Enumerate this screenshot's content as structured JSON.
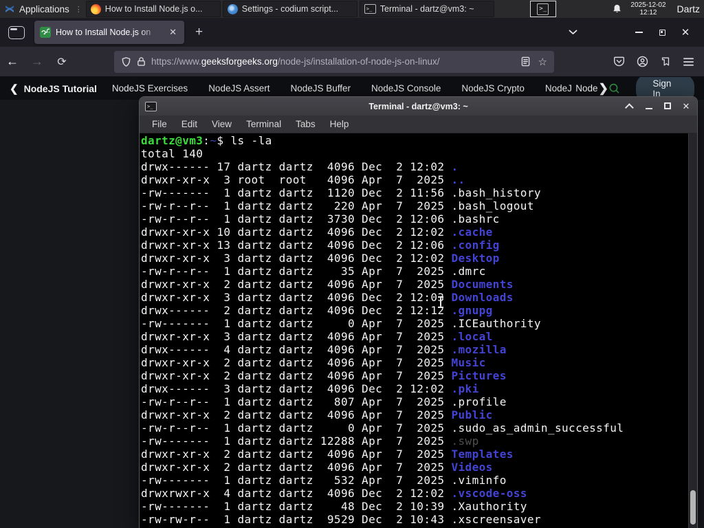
{
  "panel": {
    "applications_label": "Applications",
    "windows": [
      {
        "icon": "firefox",
        "title": "How to Install Node.js o..."
      },
      {
        "icon": "vscodium",
        "title": "Settings - codium script..."
      },
      {
        "icon": "terminal",
        "title": "Terminal - dartz@vm3: ~"
      }
    ],
    "clock_date": "2025-12-02",
    "clock_time": "12:12",
    "user_label": "Dartz"
  },
  "browser": {
    "tab_title": "How to Install Node.js on",
    "new_tab_glyph": "+",
    "close_glyph": "✕",
    "url_scheme": "https://www.",
    "url_domain": "geeksforgeeks.org",
    "url_path": "/node-js/installation-of-node-js-on-linux/",
    "star_glyph": "☆",
    "back_glyph": "←",
    "forward_glyph": "→",
    "reload_glyph": "⟳",
    "nav": {
      "back_chevron": "❮",
      "back_label": "NodeJS Tutorial",
      "links": [
        "NodeJS Exercises",
        "NodeJS Assert",
        "NodeJS Buffer",
        "NodeJS Console",
        "NodeJS Crypto",
        "NodeJS DNS"
      ],
      "more_label": "Node",
      "more_chevron": "❯",
      "signin_label": "Sign In"
    }
  },
  "terminal": {
    "window_title": "Terminal - dartz@vm3: ~",
    "menu_items": [
      "File",
      "Edit",
      "View",
      "Terminal",
      "Tabs",
      "Help"
    ],
    "prompt": {
      "user_host": "dartz@vm3",
      "colon": ":",
      "path": "~",
      "rest": "$ ls -la"
    },
    "lines": [
      {
        "type": "prompt"
      },
      {
        "type": "plain",
        "text": "total 140"
      },
      {
        "type": "ls",
        "pre": "drwx------ 17 dartz dartz  4096 Dec  2 12:02 ",
        "name": ".",
        "nameType": "dir"
      },
      {
        "type": "ls",
        "pre": "drwxr-xr-x  3 root  root   4096 Apr  7  2025 ",
        "name": "..",
        "nameType": "dir"
      },
      {
        "type": "ls",
        "pre": "-rw-------  1 dartz dartz  1120 Dec  2 11:56 ",
        "name": ".bash_history",
        "nameType": "file"
      },
      {
        "type": "ls",
        "pre": "-rw-r--r--  1 dartz dartz   220 Apr  7  2025 ",
        "name": ".bash_logout",
        "nameType": "file"
      },
      {
        "type": "ls",
        "pre": "-rw-r--r--  1 dartz dartz  3730 Dec  2 12:06 ",
        "name": ".bashrc",
        "nameType": "file"
      },
      {
        "type": "ls",
        "pre": "drwxr-xr-x 10 dartz dartz  4096 Dec  2 12:02 ",
        "name": ".cache",
        "nameType": "dir"
      },
      {
        "type": "ls",
        "pre": "drwxr-xr-x 13 dartz dartz  4096 Dec  2 12:06 ",
        "name": ".config",
        "nameType": "dir"
      },
      {
        "type": "ls",
        "pre": "drwxr-xr-x  3 dartz dartz  4096 Dec  2 12:02 ",
        "name": "Desktop",
        "nameType": "dir"
      },
      {
        "type": "ls",
        "pre": "-rw-r--r--  1 dartz dartz    35 Apr  7  2025 ",
        "name": ".dmrc",
        "nameType": "file"
      },
      {
        "type": "ls",
        "pre": "drwxr-xr-x  2 dartz dartz  4096 Apr  7  2025 ",
        "name": "Documents",
        "nameType": "dir"
      },
      {
        "type": "ls",
        "pre": "drwxr-xr-x  3 dartz dartz  4096 Dec  2 12:03 ",
        "name": "Downloads",
        "nameType": "dir"
      },
      {
        "type": "ls",
        "pre": "drwx------  2 dartz dartz  4096 Dec  2 12:12 ",
        "name": ".gnupg",
        "nameType": "dir"
      },
      {
        "type": "ls",
        "pre": "-rw-------  1 dartz dartz     0 Apr  7  2025 ",
        "name": ".ICEauthority",
        "nameType": "file"
      },
      {
        "type": "ls",
        "pre": "drwxr-xr-x  3 dartz dartz  4096 Apr  7  2025 ",
        "name": ".local",
        "nameType": "dir"
      },
      {
        "type": "ls",
        "pre": "drwx------  4 dartz dartz  4096 Apr  7  2025 ",
        "name": ".mozilla",
        "nameType": "dir"
      },
      {
        "type": "ls",
        "pre": "drwxr-xr-x  2 dartz dartz  4096 Apr  7  2025 ",
        "name": "Music",
        "nameType": "dir"
      },
      {
        "type": "ls",
        "pre": "drwxr-xr-x  2 dartz dartz  4096 Apr  7  2025 ",
        "name": "Pictures",
        "nameType": "dir"
      },
      {
        "type": "ls",
        "pre": "drwx------  3 dartz dartz  4096 Dec  2 12:02 ",
        "name": ".pki",
        "nameType": "dir"
      },
      {
        "type": "ls",
        "pre": "-rw-r--r--  1 dartz dartz   807 Apr  7  2025 ",
        "name": ".profile",
        "nameType": "file"
      },
      {
        "type": "ls",
        "pre": "drwxr-xr-x  2 dartz dartz  4096 Apr  7  2025 ",
        "name": "Public",
        "nameType": "dir"
      },
      {
        "type": "ls",
        "pre": "-rw-r--r--  1 dartz dartz     0 Apr  7  2025 ",
        "name": ".sudo_as_admin_successful",
        "nameType": "file"
      },
      {
        "type": "ls",
        "pre": "-rw-------  1 dartz dartz 12288 Apr  7  2025 ",
        "name": ".swp",
        "nameType": "dim"
      },
      {
        "type": "ls",
        "pre": "drwxr-xr-x  2 dartz dartz  4096 Apr  7  2025 ",
        "name": "Templates",
        "nameType": "dir"
      },
      {
        "type": "ls",
        "pre": "drwxr-xr-x  2 dartz dartz  4096 Apr  7  2025 ",
        "name": "Videos",
        "nameType": "dir"
      },
      {
        "type": "ls",
        "pre": "-rw-------  1 dartz dartz   532 Apr  7  2025 ",
        "name": ".viminfo",
        "nameType": "file"
      },
      {
        "type": "ls",
        "pre": "drwxrwxr-x  4 dartz dartz  4096 Dec  2 12:02 ",
        "name": ".vscode-oss",
        "nameType": "dir"
      },
      {
        "type": "ls",
        "pre": "-rw-------  1 dartz dartz    48 Dec  2 10:39 ",
        "name": ".Xauthority",
        "nameType": "file"
      },
      {
        "type": "ls",
        "pre": "-rw-rw-r--  1 dartz dartz  9529 Dec  2 10:43 ",
        "name": ".xscreensaver",
        "nameType": "file"
      }
    ]
  },
  "colors": {
    "gfg_green": "#2f8d46",
    "dir_blue": "#4343d6",
    "prompt_green": "#3ddc3d",
    "terminal_bg": "#000000",
    "panel_bg": "#2a2a2c",
    "tab_active_bg": "#42414d",
    "toolbar_bg": "#2b2a33"
  }
}
